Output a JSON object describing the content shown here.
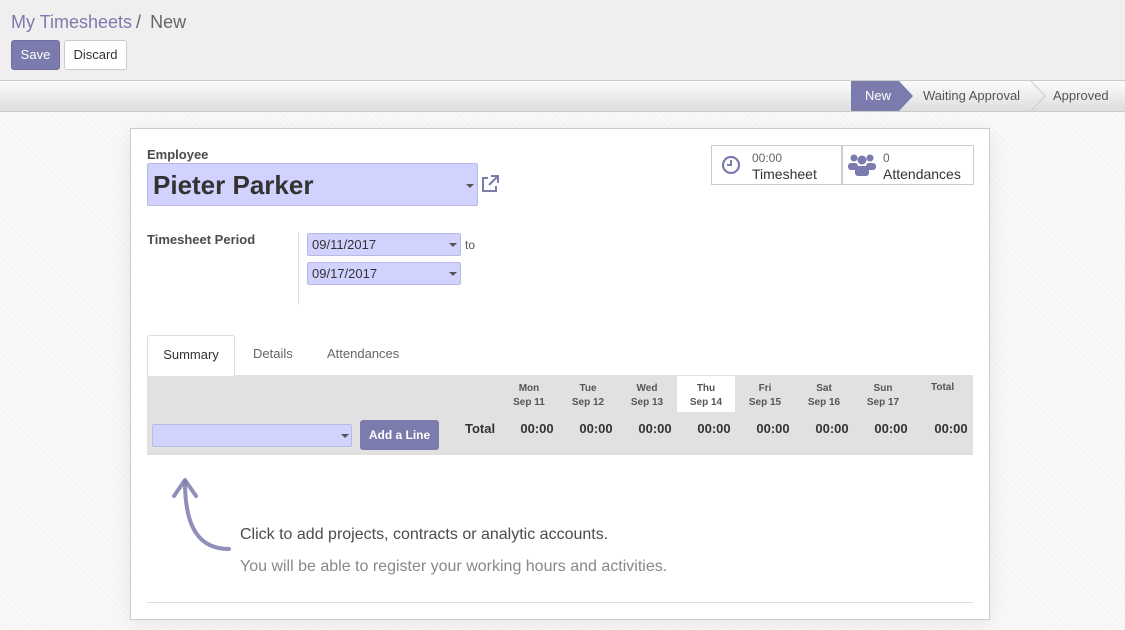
{
  "breadcrumb": {
    "parent": "My Timesheets",
    "separator": "/",
    "current": "New"
  },
  "toolbar": {
    "save_label": "Save",
    "discard_label": "Discard"
  },
  "statusbar": {
    "stages": [
      "New",
      "Waiting Approval",
      "Approved"
    ],
    "active": "New"
  },
  "form": {
    "employee_label": "Employee",
    "employee_value": "Pieter Parker",
    "period_label": "Timesheet Period",
    "date_from": "09/11/2017",
    "to_label": "to",
    "date_to": "09/17/2017"
  },
  "stats": {
    "timesheet": {
      "value": "00:00",
      "label": "Timesheet",
      "icon": "clock-icon"
    },
    "attendances": {
      "value": "0",
      "label": "Attendances",
      "icon": "users-icon"
    }
  },
  "tabs": [
    "Summary",
    "Details",
    "Attendances"
  ],
  "grid": {
    "days": [
      {
        "day": "Mon",
        "date": "Sep 11"
      },
      {
        "day": "Tue",
        "date": "Sep 12"
      },
      {
        "day": "Wed",
        "date": "Sep 13"
      },
      {
        "day": "Thu",
        "date": "Sep 14"
      },
      {
        "day": "Fri",
        "date": "Sep 15"
      },
      {
        "day": "Sat",
        "date": "Sep 16"
      },
      {
        "day": "Sun",
        "date": "Sep 17"
      }
    ],
    "today_index": 3,
    "total_header": "Total",
    "total_row_label": "Total",
    "day_totals": [
      "00:00",
      "00:00",
      "00:00",
      "00:00",
      "00:00",
      "00:00",
      "00:00"
    ],
    "grand_total": "00:00",
    "add_line_label": "Add a Line"
  },
  "help": {
    "line1": "Click to add projects, contracts or analytic accounts.",
    "line2": "You will be able to register your working hours and activities."
  },
  "colors": {
    "accent": "#7c7bad",
    "required_field": "#d2d2ff"
  }
}
